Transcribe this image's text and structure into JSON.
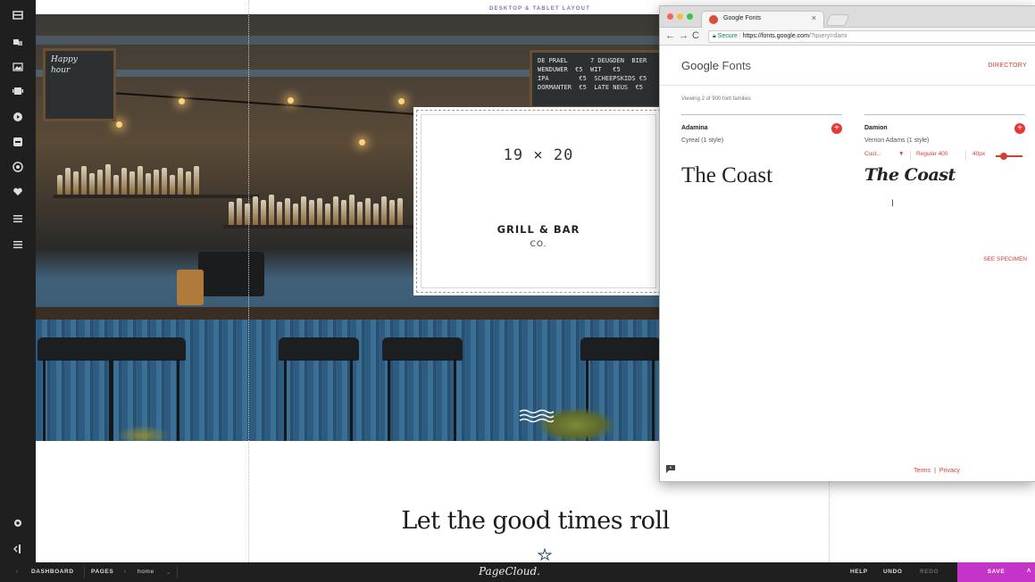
{
  "canvas": {
    "layout_label": "DESKTOP & TABLET LAYOUT",
    "chalkboard_left": "Happy\nhour",
    "chalkboard_right": "DE PRAEL      7 DEUGDEN  BIER\nWENDUWER  €5  WIT   €5\nIPA        €5  SCHEEPSKIDS €5\nDORMANTER  €5  LATE NEUS  €5",
    "logo_numbers": "19 × 20",
    "logo_name": "GRILL & BAR",
    "logo_co": "CO.",
    "headline": "Let the good times roll"
  },
  "rail": {
    "icons": [
      "section-icon",
      "stack-icon",
      "image-icon",
      "gallery-icon",
      "video-icon",
      "embed-icon",
      "social-icon",
      "heart-icon",
      "menu-icon",
      "list-icon",
      "settings-icon",
      "collapse-icon"
    ]
  },
  "browser": {
    "tab_title": "Google Fonts",
    "tab_close": "×",
    "secure_label": "Secure",
    "url_host": "https://fonts.google.com",
    "url_rest": "/?query=dami",
    "logo_google": "Google",
    "logo_fonts": "Fonts",
    "directory": "DIRECTORY",
    "viewing": "Viewing 2 of 900 font families",
    "fonts": [
      {
        "family": "Adamina",
        "author": "Cyreal (1 style)",
        "sample": "The Coast"
      },
      {
        "family": "Damion",
        "author": "Vernon Adams (1 style)",
        "sample": "The Coast"
      }
    ],
    "controls": {
      "custom": "Cust...",
      "style": "Regular 400",
      "size": "40px",
      "slider_level": 0.3
    },
    "see_specimen": "SEE SPECIMEN",
    "terms": "Terms",
    "separator": "|",
    "privacy": "Privacy",
    "text_cursor": "I",
    "add_symbol": "+"
  },
  "bottombar": {
    "dashboard": "DASHBOARD",
    "pages": "PAGES",
    "page_name": "home",
    "brand": "PageCloud.",
    "help": "HELP",
    "undo": "UNDO",
    "redo": "REDO",
    "save": "SAVE"
  },
  "colors": {
    "accent": "#d23f31",
    "save": "#c534c9",
    "rail": "#1f1f1f",
    "label": "#8a6fb0"
  }
}
